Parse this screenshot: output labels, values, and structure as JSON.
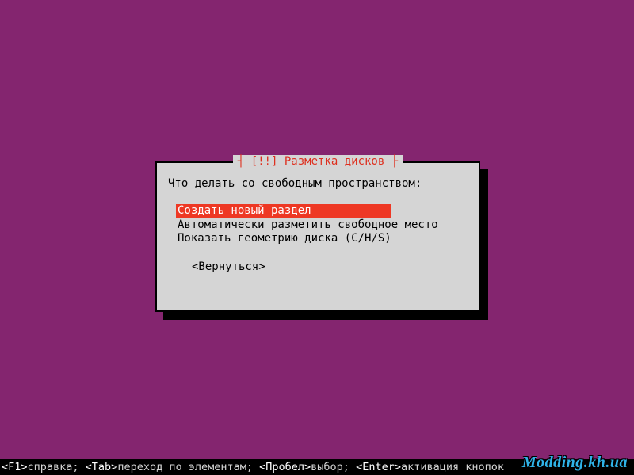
{
  "dialog": {
    "title_prefix": "[!!]",
    "title": "Разметка дисков",
    "prompt": "Что делать со свободным пространством:",
    "options": [
      {
        "label": "Создать новый раздел",
        "selected": true
      },
      {
        "label": "Автоматически разметить свободное место",
        "selected": false
      },
      {
        "label": "Показать геометрию диска (C/H/S)",
        "selected": false
      }
    ],
    "back_label": "<Вернуться>"
  },
  "footer": {
    "f1_key": "<F1>",
    "f1_label": "справка; ",
    "tab_key": "<Tab>",
    "tab_label": "переход по элементам; ",
    "space_key": "<Пробел>",
    "space_label": "выбор; ",
    "enter_key": "<Enter>",
    "enter_label": "активация кнопок"
  },
  "watermark": "Modding.kh.ua"
}
